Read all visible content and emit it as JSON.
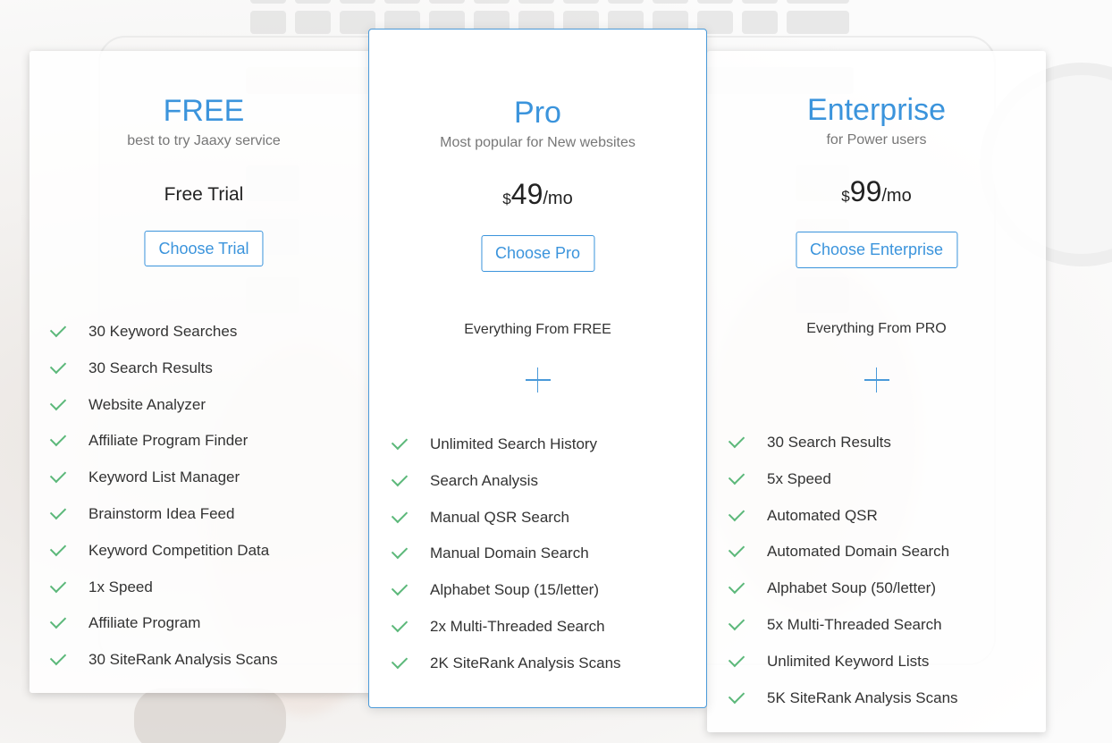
{
  "plans": {
    "free": {
      "name": "FREE",
      "subtitle": "best to try Jaaxy service",
      "price_text": "Free Trial",
      "button_label": "Choose Trial",
      "features": [
        "30 Keyword Searches",
        "30 Search Results",
        "Website Analyzer",
        "Affiliate Program Finder",
        "Keyword List Manager",
        "Brainstorm Idea Feed",
        "Keyword Competition Data",
        "1x Speed",
        "Affiliate Program",
        "30 SiteRank Analysis Scans"
      ]
    },
    "pro": {
      "name": "Pro",
      "subtitle": "Most popular for New websites",
      "currency": "$",
      "amount": "49",
      "period": "/mo",
      "button_label": "Choose Pro",
      "everything_from": "Everything From FREE",
      "features": [
        "Unlimited Search History",
        "Search Analysis",
        "Manual QSR Search",
        "Manual Domain Search",
        "Alphabet Soup (15/letter)",
        "2x Multi-Threaded Search",
        "2K SiteRank Analysis Scans"
      ]
    },
    "enterprise": {
      "name": "Enterprise",
      "subtitle": "for Power users",
      "currency": "$",
      "amount": "99",
      "period": "/mo",
      "button_label": "Choose Enterprise",
      "everything_from": "Everything From PRO",
      "features": [
        "30 Search Results",
        "5x Speed",
        "Automated QSR",
        "Automated Domain Search",
        "Alphabet Soup (50/letter)",
        "5x Multi-Threaded Search",
        "Unlimited Keyword Lists",
        "5K SiteRank Analysis Scans"
      ]
    }
  },
  "icons": {
    "feature": "check-icon",
    "plus": "plus-icon"
  },
  "colors": {
    "accent": "#3b94dc",
    "check": "#5cb87a",
    "text": "#333333"
  }
}
